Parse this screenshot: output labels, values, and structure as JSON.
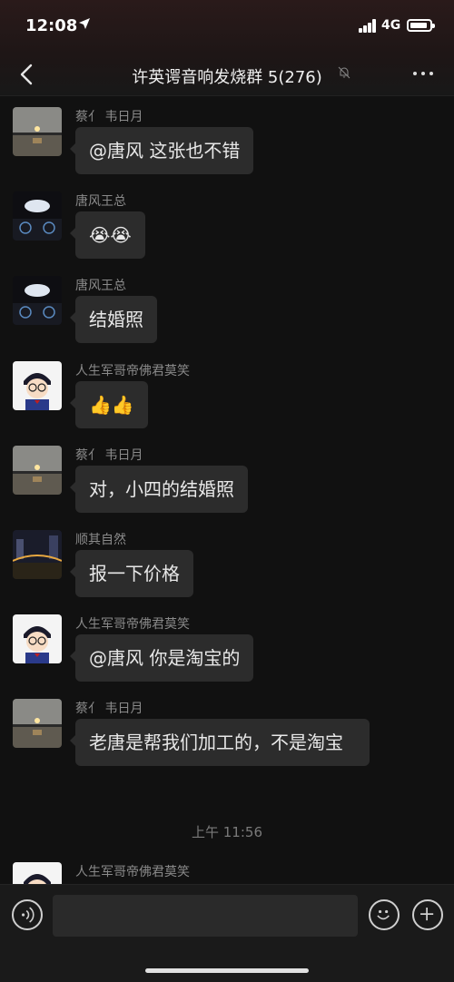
{
  "status_bar": {
    "time": "12:08",
    "location_icon": "location-arrow-icon",
    "network": "4G",
    "signal_icon": "signal-bars-icon",
    "battery_icon": "battery-icon"
  },
  "nav": {
    "back_icon": "chevron-left-icon",
    "title": "许英谔音响发烧群 5(276)",
    "mute_icon": "bell-muted-icon",
    "more_icon": "more-dots-icon"
  },
  "messages": [
    {
      "sender": "蔡亻 韦日月",
      "text": "@唐风 这张也不错",
      "avatar": "sunset-lake-avatar"
    },
    {
      "sender": "唐风王总",
      "text": "😭😭",
      "avatar": "car-dashboard-avatar"
    },
    {
      "sender": "唐风王总",
      "text": "结婚照",
      "avatar": "car-dashboard-avatar"
    },
    {
      "sender": "人生军哥帝佛君莫笑",
      "text": "👍👍",
      "avatar": "cartoon-boy-avatar"
    },
    {
      "sender": "蔡亻 韦日月",
      "text": "对，小四的结婚照",
      "avatar": "sunset-lake-avatar"
    },
    {
      "sender": "顺其自然",
      "text": "报一下价格",
      "avatar": "night-bridge-avatar"
    },
    {
      "sender": "人生军哥帝佛君莫笑",
      "text": "@唐风 你是淘宝的",
      "avatar": "cartoon-boy-avatar"
    },
    {
      "sender": "蔡亻 韦日月",
      "text": "老唐是帮我们加工的，不是淘宝",
      "avatar": "sunset-lake-avatar"
    },
    {
      "sender": "人生军哥帝佛君莫笑",
      "text": "",
      "avatar": "cartoon-boy-avatar"
    }
  ],
  "time_separator": "上午 11:56",
  "input_bar": {
    "voice_icon": "voice-wave-icon",
    "input_value": "",
    "emoji_icon": "smiley-icon",
    "plus_icon": "plus-circle-icon"
  },
  "colors": {
    "background": "#111111",
    "bubble": "#2c2c2c",
    "sender_text": "#8a8a8a"
  }
}
